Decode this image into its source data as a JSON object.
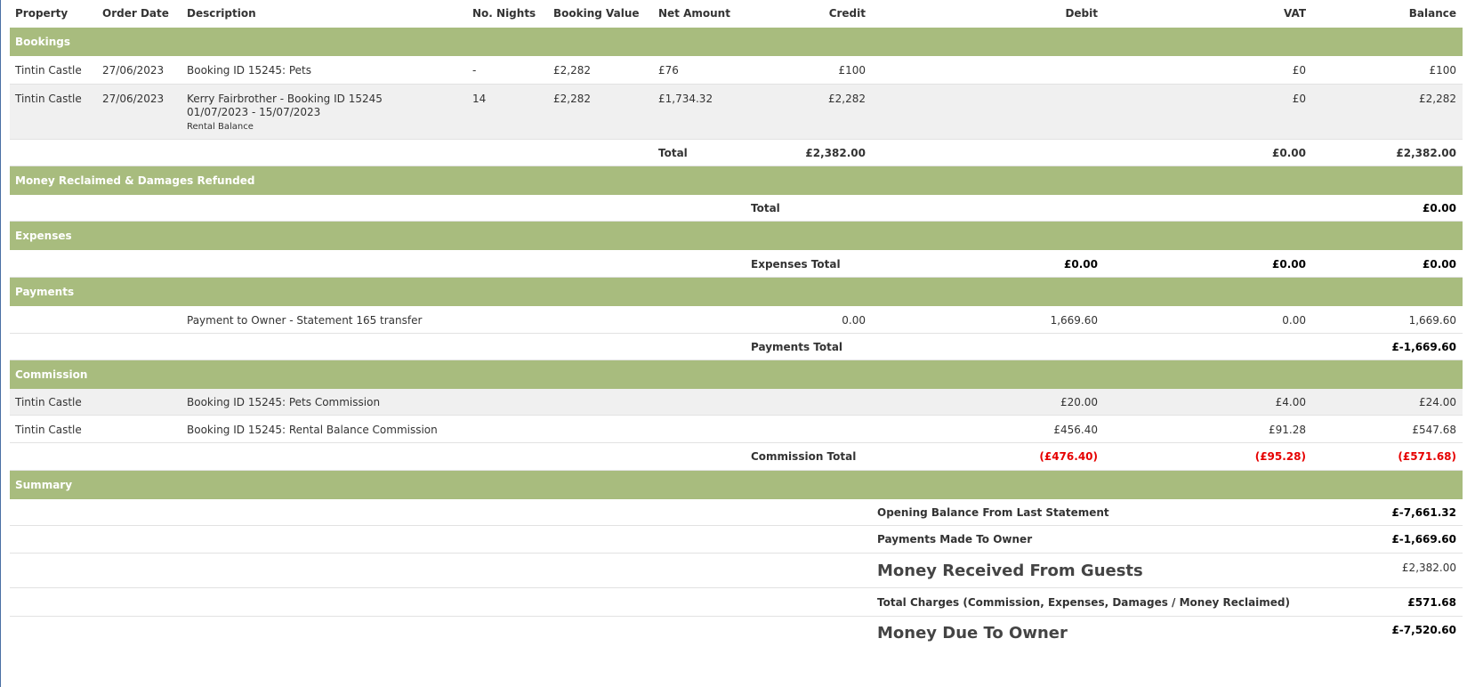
{
  "columns": [
    "Property",
    "Order Date",
    "Description",
    "No. Nights",
    "Booking Value",
    "Net Amount",
    "Credit",
    "Debit",
    "VAT",
    "Balance"
  ],
  "sections": {
    "bookings": "Bookings",
    "money_reclaimed": "Money Reclaimed & Damages Refunded",
    "expenses": "Expenses",
    "payments": "Payments",
    "commission": "Commission",
    "summary": "Summary"
  },
  "bookings": {
    "rows": [
      {
        "property": "Tintin Castle",
        "date": "27/06/2023",
        "desc": "Booking ID 15245: Pets",
        "desc2": "",
        "desc3": "",
        "nights": "-",
        "booking_value": "£2,282",
        "net": "£76",
        "credit": "£100",
        "vat": "£0",
        "balance": "£100"
      },
      {
        "property": "Tintin Castle",
        "date": "27/06/2023",
        "desc": "Kerry Fairbrother - Booking ID 15245",
        "desc2": "01/07/2023 - 15/07/2023",
        "desc3": "Rental Balance",
        "nights": "14",
        "booking_value": "£2,282",
        "net": "£1,734.32",
        "credit": "£2,282",
        "vat": "£0",
        "balance": "£2,282"
      }
    ],
    "total": {
      "label": "Total",
      "credit": "£2,382.00",
      "vat": "£0.00",
      "balance": "£2,382.00"
    }
  },
  "money_reclaimed": {
    "total_label": "Total",
    "balance": "£0.00"
  },
  "expenses": {
    "total_label": "Expenses Total",
    "debit": "£0.00",
    "vat": "£0.00",
    "balance": "£0.00"
  },
  "payments": {
    "rows": [
      {
        "desc": "Payment to Owner - Statement 165 transfer",
        "credit": "0.00",
        "debit": "1,669.60",
        "vat": "0.00",
        "balance": "1,669.60"
      }
    ],
    "total_label": "Payments Total",
    "balance": "£-1,669.60"
  },
  "commission": {
    "rows": [
      {
        "property": "Tintin Castle",
        "desc": "Booking ID 15245: Pets Commission",
        "debit": "£20.00",
        "vat": "£4.00",
        "balance": "£24.00"
      },
      {
        "property": "Tintin Castle",
        "desc": "Booking ID 15245: Rental Balance Commission",
        "debit": "£456.40",
        "vat": "£91.28",
        "balance": "£547.68"
      }
    ],
    "total_label": "Commission Total",
    "debit": "(£476.40)",
    "vat": "(£95.28)",
    "balance": "(£571.68)"
  },
  "summary": {
    "opening_label": "Opening Balance From Last Statement",
    "opening_value": "£-7,661.32",
    "payments_label": "Payments Made To Owner",
    "payments_value": "£-1,669.60",
    "received_label": "Money Received From Guests",
    "received_value": "£2,382.00",
    "charges_label": "Total Charges (Commission, Expenses, Damages / Money Reclaimed)",
    "charges_value": "£571.68",
    "due_label": "Money Due To Owner",
    "due_value": "£-7,520.60"
  },
  "colors": {
    "section_band": "#a8bc7e",
    "negative": "#e60000",
    "row_shade": "#f0f0f0"
  }
}
